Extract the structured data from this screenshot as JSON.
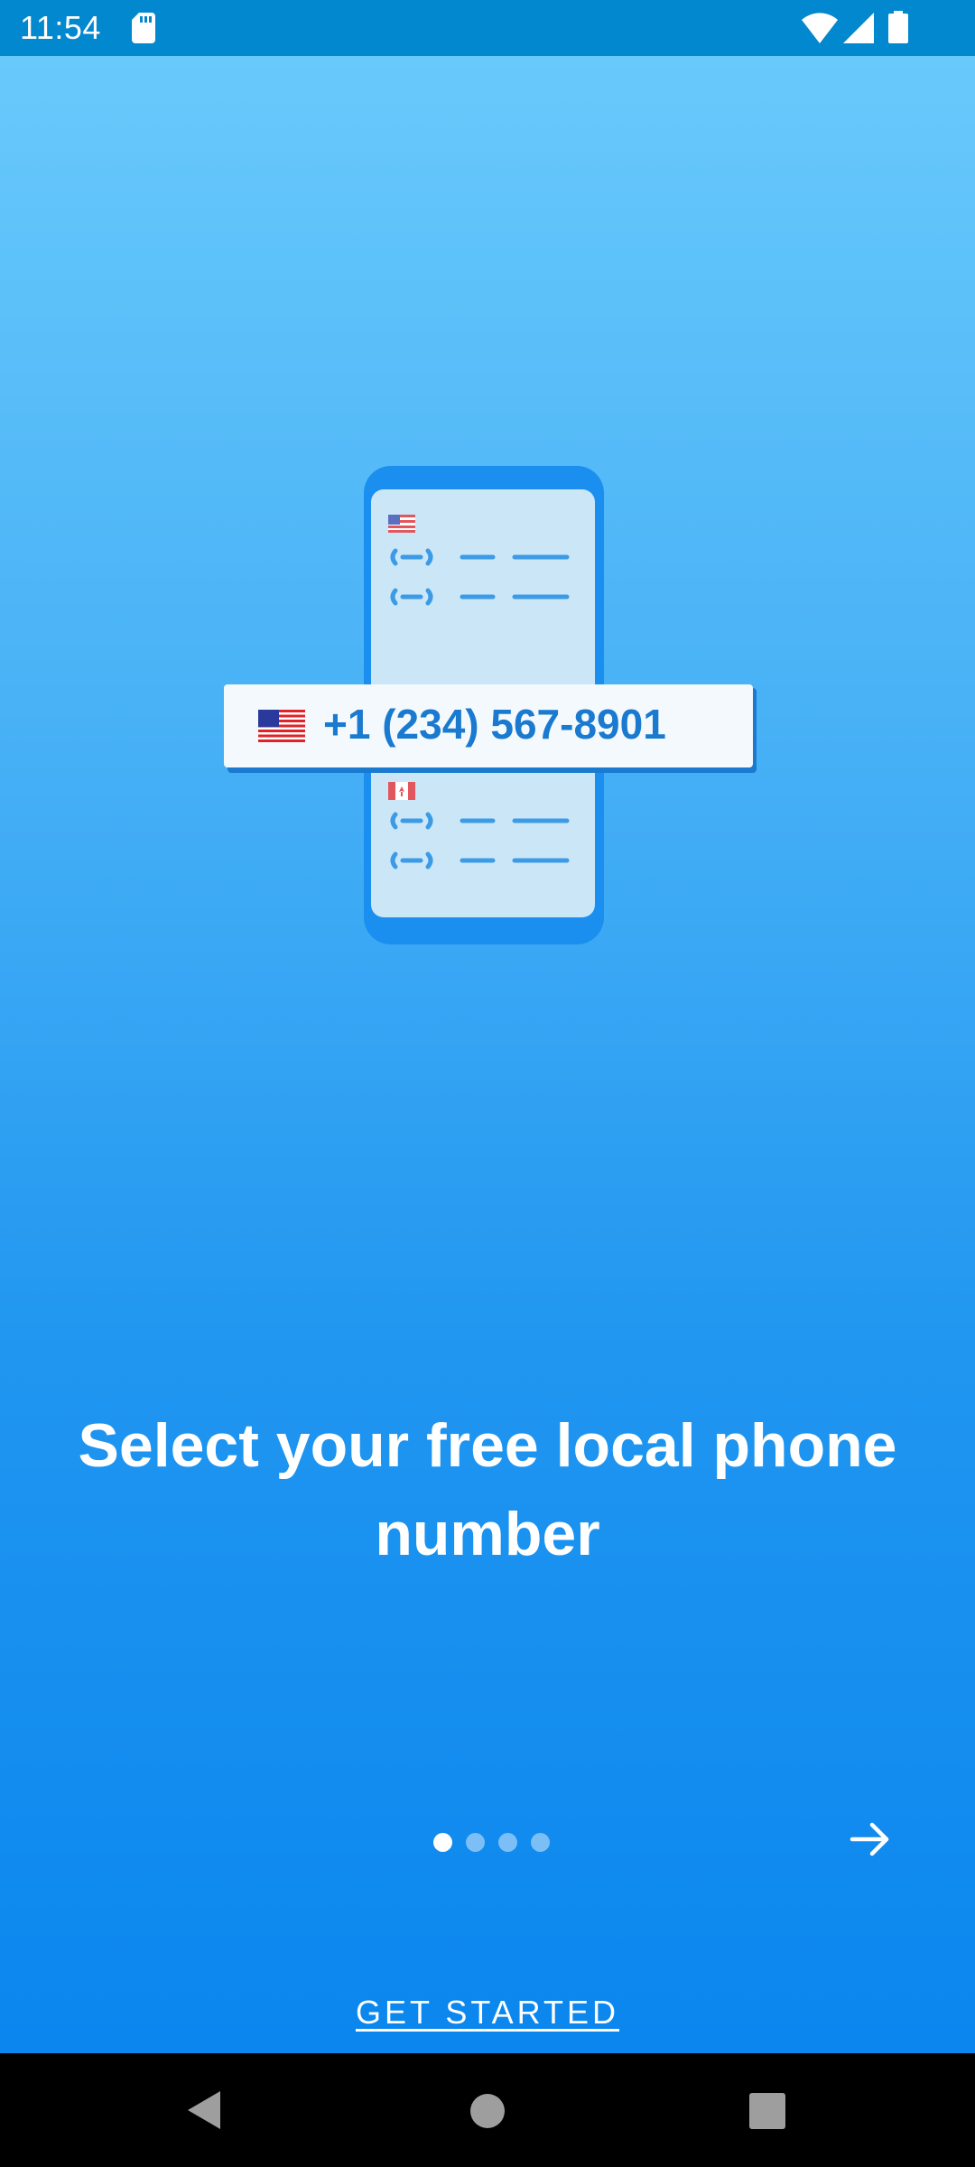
{
  "status_bar": {
    "time": "11:54",
    "icons": [
      "sd-card-icon",
      "wifi-icon",
      "cell-signal-icon",
      "battery-icon"
    ]
  },
  "illustration": {
    "phone_number": "+1 (234) 567-8901",
    "icons": [
      "us-flag-icon",
      "canada-flag-icon"
    ]
  },
  "onboarding": {
    "headline": "Select your free local phone number",
    "pager": {
      "total": 4,
      "active_index": 0
    },
    "next_icon": "arrow-right-icon",
    "cta_label": "GET STARTED"
  },
  "nav_bar": {
    "icons": [
      "back-icon",
      "home-icon",
      "recents-icon"
    ]
  },
  "colors": {
    "status_bar": "#0288cf",
    "gradient_top": "#68c9fb",
    "gradient_bottom": "#0a86ee",
    "phone_frame": "#1b8ff0",
    "phone_screen": "#cbe7f7",
    "number_text": "#1a7ad0"
  }
}
